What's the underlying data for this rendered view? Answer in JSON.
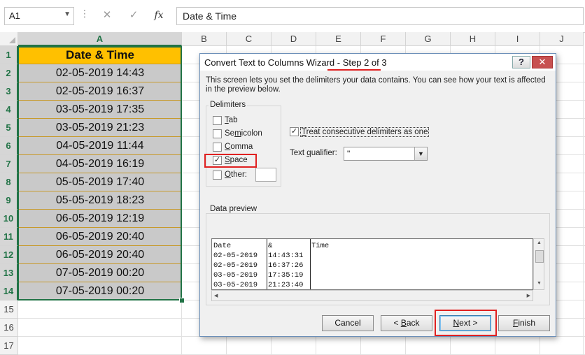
{
  "formula_bar": {
    "name_box": "A1",
    "cancel_glyph": "✕",
    "enter_glyph": "✓",
    "fx_label": "fx",
    "formula_value": "Date & Time"
  },
  "columns": [
    "A",
    "B",
    "C",
    "D",
    "E",
    "F",
    "G",
    "H",
    "I",
    "J"
  ],
  "selected_column": "A",
  "rows": [
    "1",
    "2",
    "3",
    "4",
    "5",
    "6",
    "7",
    "8",
    "9",
    "10",
    "11",
    "12",
    "13",
    "14",
    "15",
    "16",
    "17"
  ],
  "sheet": {
    "header": "Date & Time",
    "values": [
      "02-05-2019 14:43",
      "02-05-2019 16:37",
      "03-05-2019 17:35",
      "03-05-2019 21:23",
      "04-05-2019 11:44",
      "04-05-2019 16:19",
      "05-05-2019 17:40",
      "05-05-2019 18:23",
      "06-05-2019 12:19",
      "06-05-2019 20:40",
      "06-05-2019 20:40",
      "07-05-2019 00:20",
      "07-05-2019 00:20"
    ],
    "header_color": "#ffc000",
    "cell_color": "#c9c9c9",
    "selection_color": "#217346"
  },
  "dialog": {
    "title_prefix": "Convert Text to Columns Wizard - ",
    "title_step": "Step 2 of 3",
    "help_label": "?",
    "close_label": "✕",
    "description": "This screen lets you set the delimiters your data contains.  You can see how your text is affected in the preview below.",
    "delimiters_label": "Delimiters",
    "delimiters": [
      {
        "label": "Tab",
        "checked": false
      },
      {
        "label": "Semicolon",
        "checked": false
      },
      {
        "label": "Comma",
        "checked": false
      },
      {
        "label": "Space",
        "checked": true
      },
      {
        "label": "Other:",
        "checked": false
      }
    ],
    "treat_consecutive_label": "Treat consecutive delimiters as one",
    "treat_consecutive_checked": true,
    "text_qualifier_label": "Text qualifier:",
    "text_qualifier_value": "\"",
    "data_preview_label": "Data preview",
    "preview_rows": [
      [
        "Date",
        "&",
        "Time"
      ],
      [
        "02-05-2019",
        "14:43:31",
        ""
      ],
      [
        "02-05-2019",
        "16:37:26",
        ""
      ],
      [
        "03-05-2019",
        "17:35:19",
        ""
      ],
      [
        "03-05-2019",
        "21:23:40",
        ""
      ]
    ],
    "buttons": {
      "cancel": "Cancel",
      "back": "< Back",
      "next": "Next >",
      "finish": "Finish"
    },
    "highlight_color": "#e02020"
  }
}
